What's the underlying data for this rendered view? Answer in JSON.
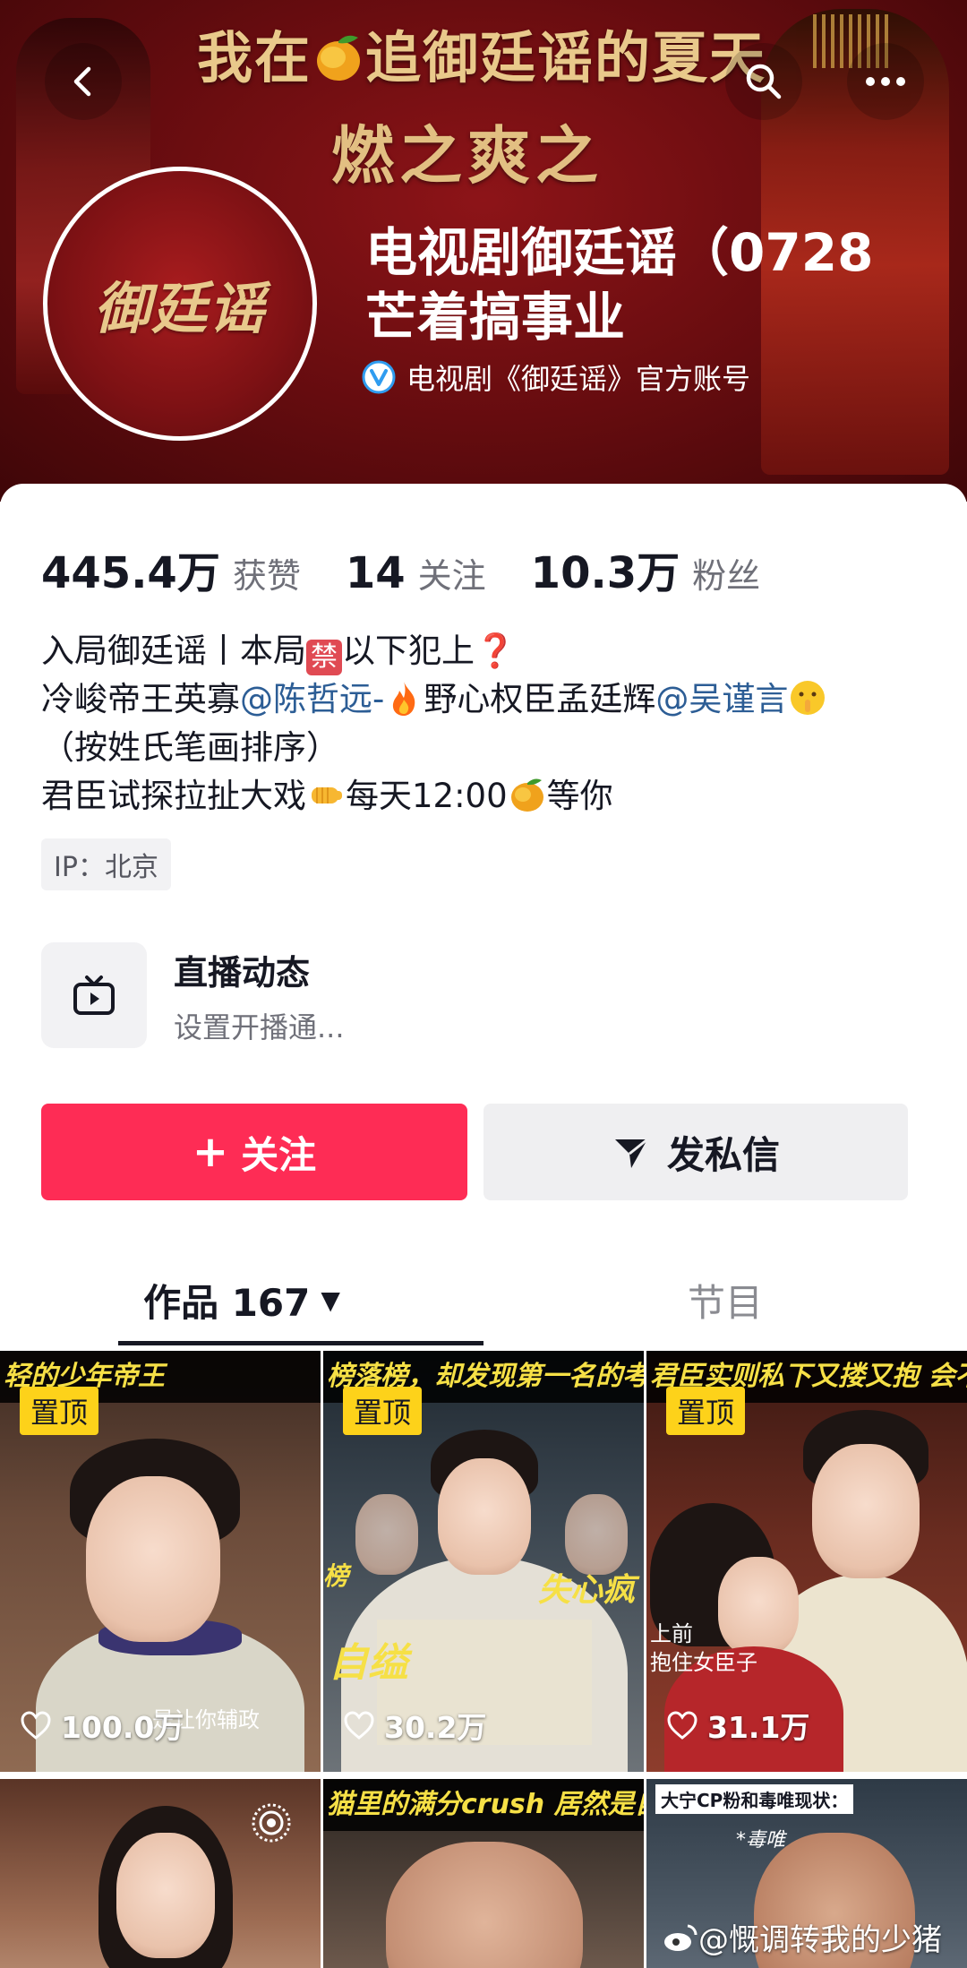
{
  "banner": {
    "line1_before": "我在",
    "line1_after": "追御廷谣的夏天",
    "line2": "燃之爽之"
  },
  "profile": {
    "avatar_text": "御廷谣",
    "name_line1": "电视剧御廷谣（0728",
    "name_line2": "芒着搞事业",
    "verified_text": "电视剧《御廷谣》官方账号"
  },
  "stats": [
    {
      "num": "445.4万",
      "label": "获赞"
    },
    {
      "num": "14",
      "label": "关注"
    },
    {
      "num": "10.3万",
      "label": "粉丝"
    }
  ],
  "bio": {
    "l1_a": "入局御廷谣丨本局",
    "l1_ban": "禁",
    "l1_b": "以下犯上",
    "l1_q": "❓",
    "l2_a": "冷峻帝王英寡",
    "l2_mention1": "@陈哲远-",
    "l2_b": "野心权臣孟廷辉",
    "l2_mention2": "@吴谨言",
    "l3": "（按姓氏笔画排序）",
    "l4_a": "君臣试探拉扯大戏",
    "l4_b": "每天12:00",
    "l4_c": "等你"
  },
  "ip": "IP：北京",
  "live": {
    "title": "直播动态",
    "subtitle": "设置开播通..."
  },
  "buttons": {
    "follow_plus": "+",
    "follow": "关注",
    "message": "发私信"
  },
  "tabs": {
    "works": "作品 167",
    "works_caret": "▼",
    "shows": "节目"
  },
  "videos": [
    {
      "caption": "轻的少年帝王",
      "pin": "置顶",
      "likes": "100.0万",
      "subtitle": "是让你辅政"
    },
    {
      "caption": "榜落榜，却发现第一名的考卷是自己",
      "pin": "置顶",
      "likes": "30.2万",
      "overlay1": "失心疯",
      "overlay2": "自缢",
      "overlay3": "榜"
    },
    {
      "caption": "君臣实则私下又搂又抱 会不会",
      "pin": "置顶",
      "likes": "31.1万",
      "overlay1": "上前",
      "overlay2": "抱住女臣子"
    },
    {
      "caption": "",
      "pin": "",
      "likes": ""
    },
    {
      "caption": "猫里的满分crush 居然是自己的",
      "pin": "",
      "likes": ""
    },
    {
      "caption": "大宁CP粉和毒唯现状：",
      "pin": "",
      "likes": "",
      "overlay1": "*毒唯"
    }
  ],
  "watermark": "@慨调转我的少猪",
  "colors": {
    "accent": "#fe2c55",
    "pin": "#fdd21a",
    "mention": "#2c5d95",
    "banner": "#7d1114"
  }
}
